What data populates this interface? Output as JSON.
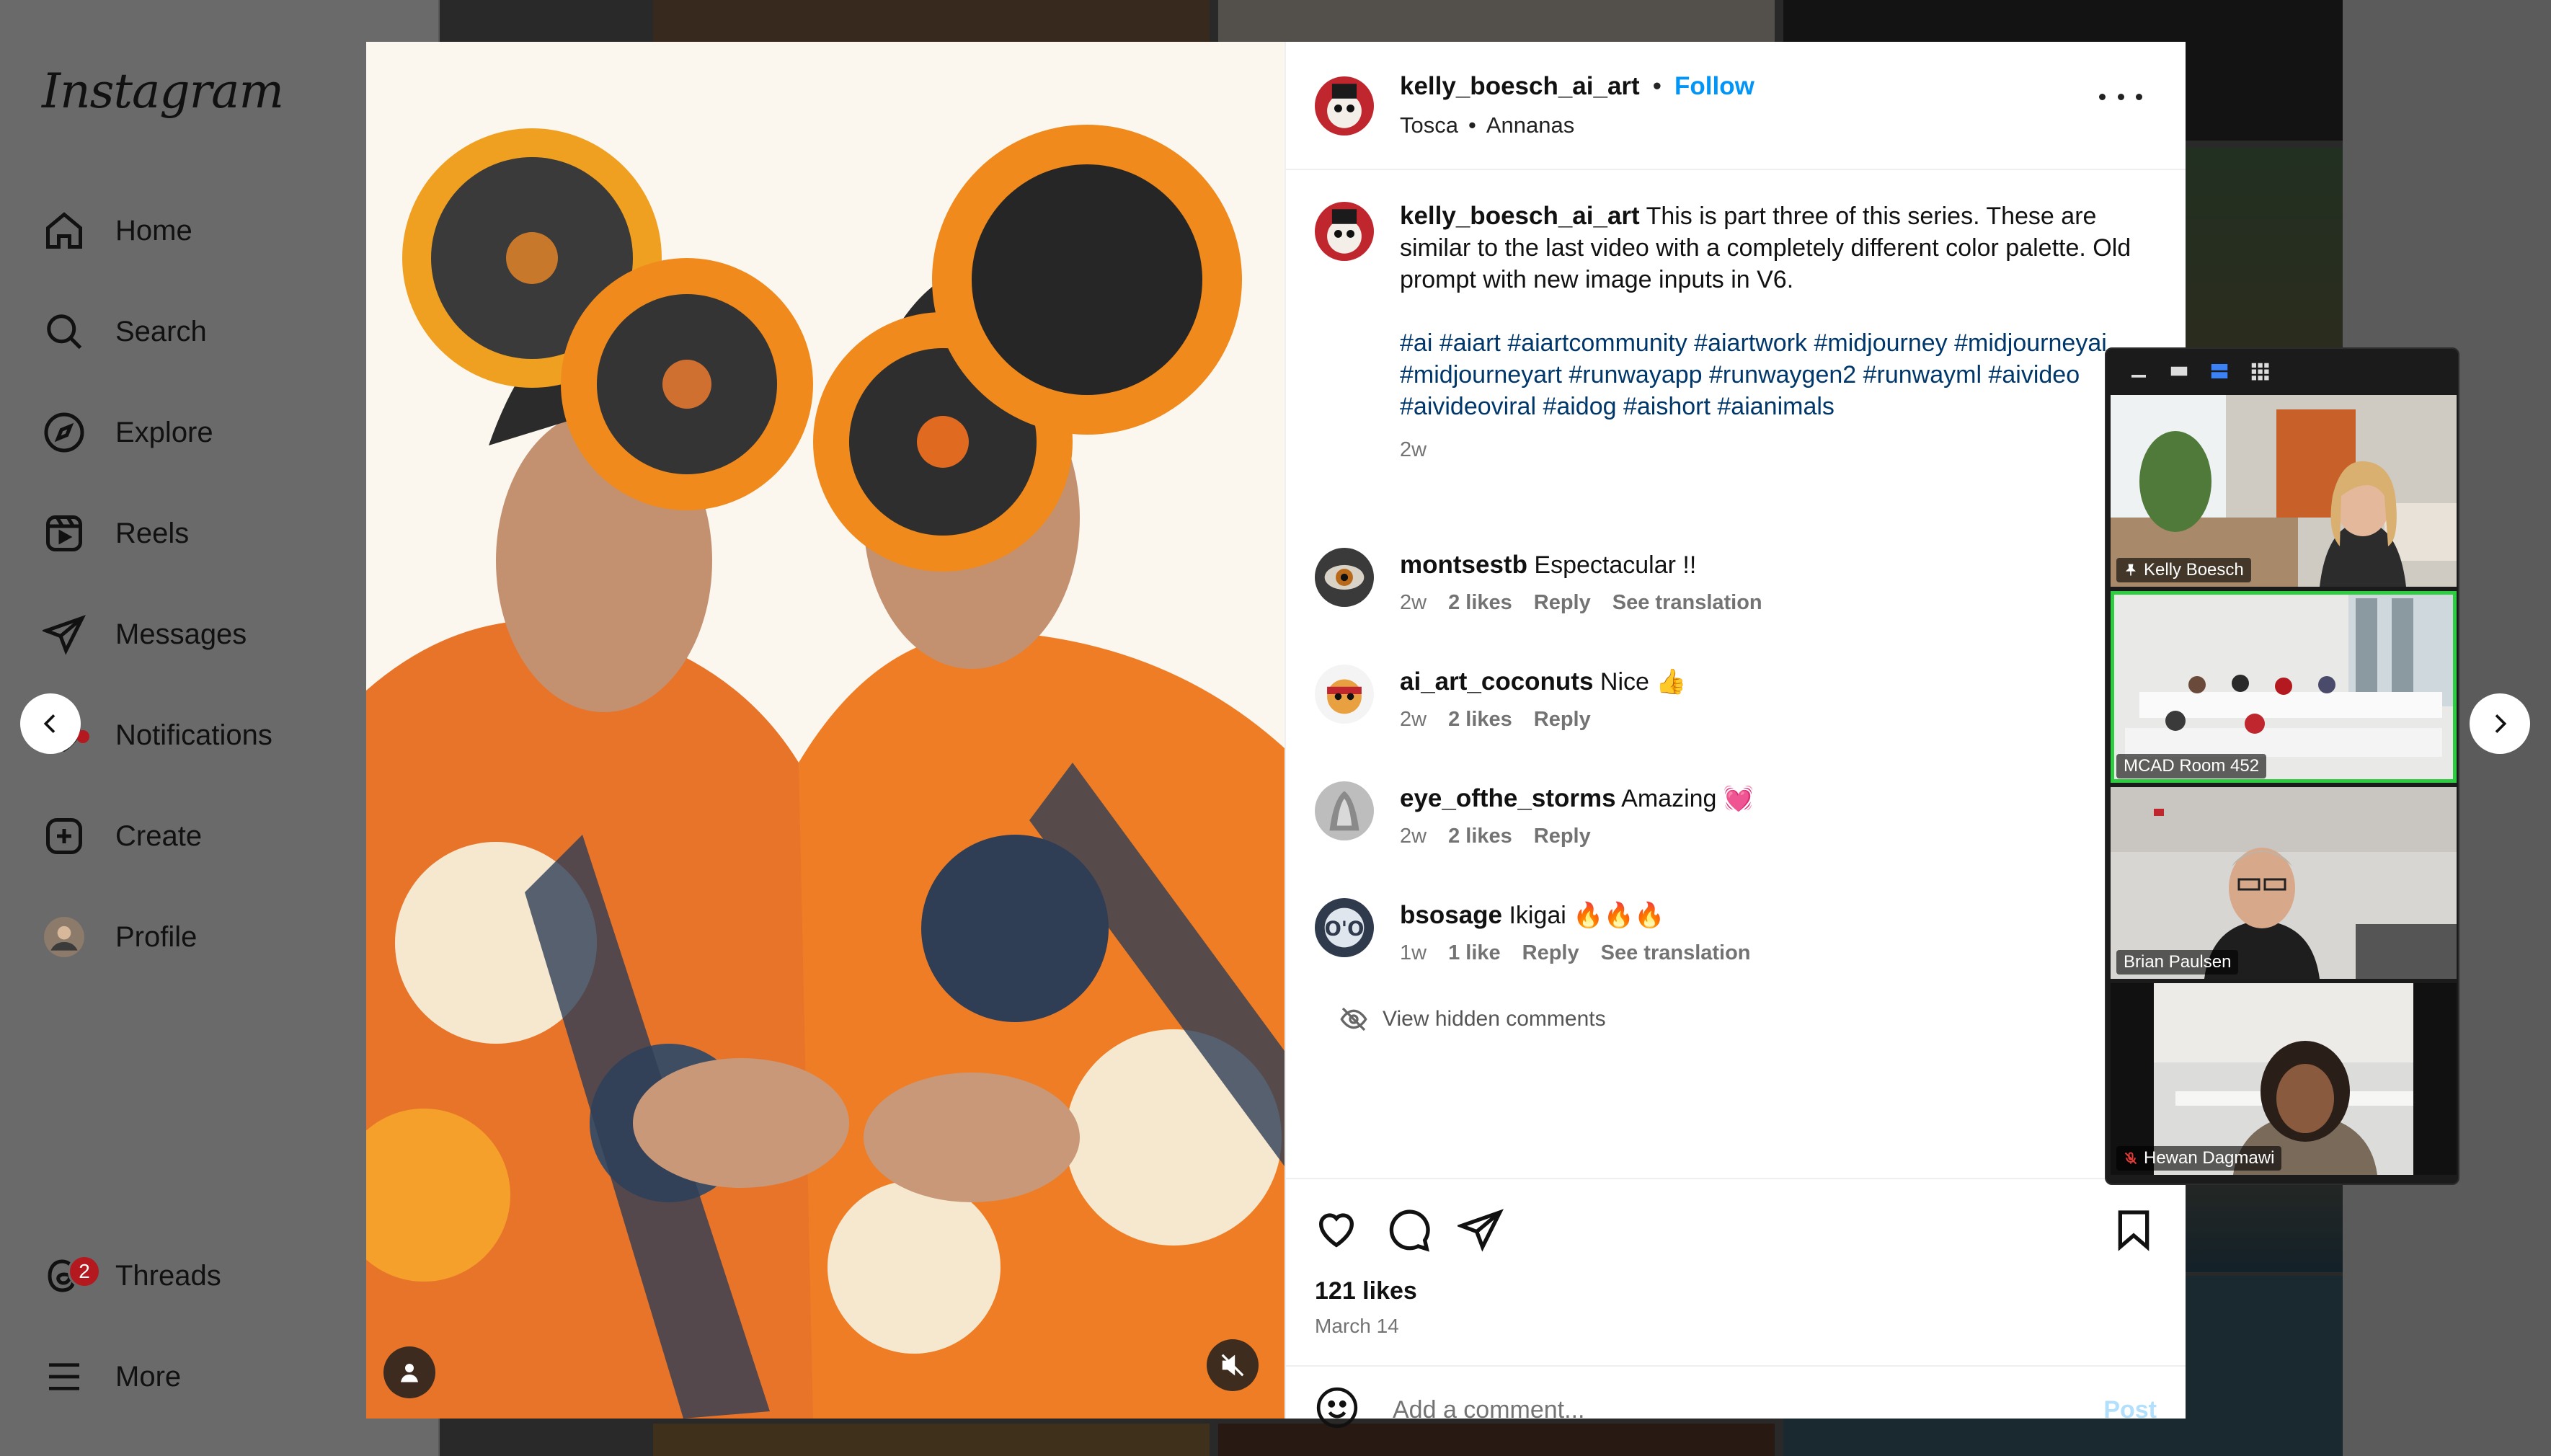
{
  "app": {
    "logo": "Instagram"
  },
  "sidebar": {
    "items": [
      {
        "label": "Home",
        "icon": "home-icon"
      },
      {
        "label": "Search",
        "icon": "search-icon"
      },
      {
        "label": "Explore",
        "icon": "compass-icon"
      },
      {
        "label": "Reels",
        "icon": "reels-icon"
      },
      {
        "label": "Messages",
        "icon": "paper-plane-icon"
      },
      {
        "label": "Notifications",
        "icon": "heart-icon"
      },
      {
        "label": "Create",
        "icon": "plus-square-icon"
      },
      {
        "label": "Profile",
        "icon": "profile-avatar"
      }
    ],
    "threads": {
      "label": "Threads",
      "badge": "2"
    },
    "more": {
      "label": "More"
    }
  },
  "post": {
    "author": "kelly_boesch_ai_art",
    "separator": "•",
    "follow_label": "Follow",
    "audio_artist": "Tosca",
    "audio_track": "Annanas",
    "caption_text": "This is part three of this series. These are similar to the last video with a completely different color palette. Old prompt with new image inputs in V6.",
    "hashtags": "#ai #aiart #aiartcommunity #aiartwork #midjourney #midjourneyai #midjourneyart #runwayapp #runwaygen2 #runwayml #aivideo #aivideoviral #aidog #aishort #aianimals",
    "caption_age": "2w",
    "comments": [
      {
        "user": "montsestb",
        "text": "Espectacular !!",
        "age": "2w",
        "likes": "2 likes",
        "reply": "Reply",
        "translate": "See translation"
      },
      {
        "user": "ai_art_coconuts",
        "text": "Nice 👍",
        "age": "2w",
        "likes": "2 likes",
        "reply": "Reply"
      },
      {
        "user": "eye_ofthe_storms",
        "text": "Amazing 💓",
        "age": "2w",
        "likes": "2 likes",
        "reply": "Reply"
      },
      {
        "user": "bsosage",
        "text": "Ikigai 🔥🔥🔥",
        "age": "1w",
        "likes": "1 like",
        "reply": "Reply",
        "translate": "See translation"
      }
    ],
    "view_hidden": "View hidden comments",
    "likes_count": "121 likes",
    "date": "March 14",
    "comment_placeholder": "Add a comment...",
    "post_label": "Post"
  },
  "zoom": {
    "participants": [
      {
        "name": "Kelly Boesch",
        "pinned": true
      },
      {
        "name": "MCAD Room 452",
        "active": true
      },
      {
        "name": "Brian Paulsen"
      },
      {
        "name": "Hewan Dagmawi",
        "muted": true
      }
    ]
  },
  "colors": {
    "accent": "#0095f6",
    "hashtag": "#00376b",
    "badge": "#b3191f",
    "zoom_active": "#2ecc40",
    "art_orange": "#f08a1c"
  }
}
